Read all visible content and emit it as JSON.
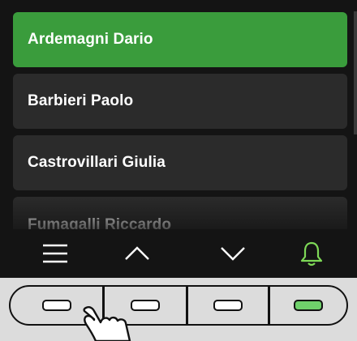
{
  "contacts": [
    {
      "name": "Ardemagni Dario",
      "selected": true
    },
    {
      "name": "Barbieri Paolo",
      "selected": false
    },
    {
      "name": "Castrovillari Giulia",
      "selected": false
    },
    {
      "name": "Fumagalli Riccardo",
      "selected": false
    }
  ],
  "toolbar": {
    "icons": [
      "menu-icon",
      "chevron-up-icon",
      "chevron-down-icon",
      "bell-icon"
    ]
  },
  "colors": {
    "selected": "#3a9c3c",
    "row": "#2b2b2b",
    "bell": "#7ed957",
    "hw_green": "#6fd16b"
  },
  "hardware_buttons": [
    {
      "name": "menu-hw-button",
      "color": "white"
    },
    {
      "name": "up-hw-button",
      "color": "white"
    },
    {
      "name": "down-hw-button",
      "color": "white"
    },
    {
      "name": "bell-hw-button",
      "color": "green"
    }
  ]
}
